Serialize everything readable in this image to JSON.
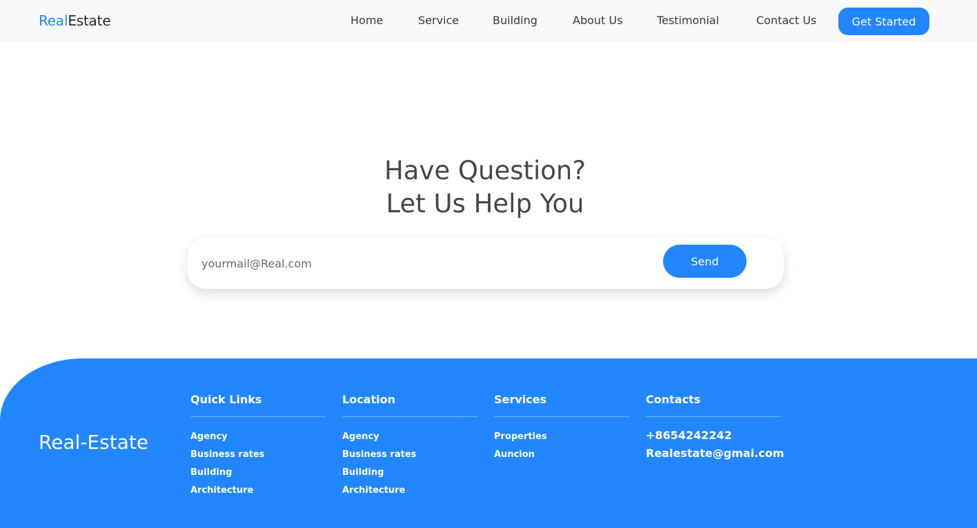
{
  "header": {
    "logo_accent": "Real",
    "logo_rest": "Estate",
    "nav": [
      "Home",
      "Service",
      "Building",
      "About Us",
      "Testimonial",
      "Contact Us"
    ],
    "cta_label": "Get Started"
  },
  "hero": {
    "title_line1": "Have Question?",
    "title_line2": "Let Us Help You",
    "email_placeholder": "yourmail@Real.com",
    "send_label": "Send"
  },
  "footer": {
    "brand": "Real-Estate",
    "quick_links": {
      "title": "Quick Links",
      "items": [
        "Agency",
        "Business rates",
        "Building",
        "Architecture"
      ]
    },
    "location": {
      "title": "Location",
      "items": [
        "Agency",
        "Business rates",
        "Building",
        "Architecture"
      ]
    },
    "services": {
      "title": "Services",
      "items": [
        "Properties",
        "Auncion"
      ]
    },
    "contacts": {
      "title": "Contacts",
      "items": [
        "+8654242242",
        "Realestate@gmai.com"
      ]
    }
  },
  "colors": {
    "accent": "#2286ff",
    "text_dark": "#45464a",
    "header_bg": "#f8f8f8"
  }
}
